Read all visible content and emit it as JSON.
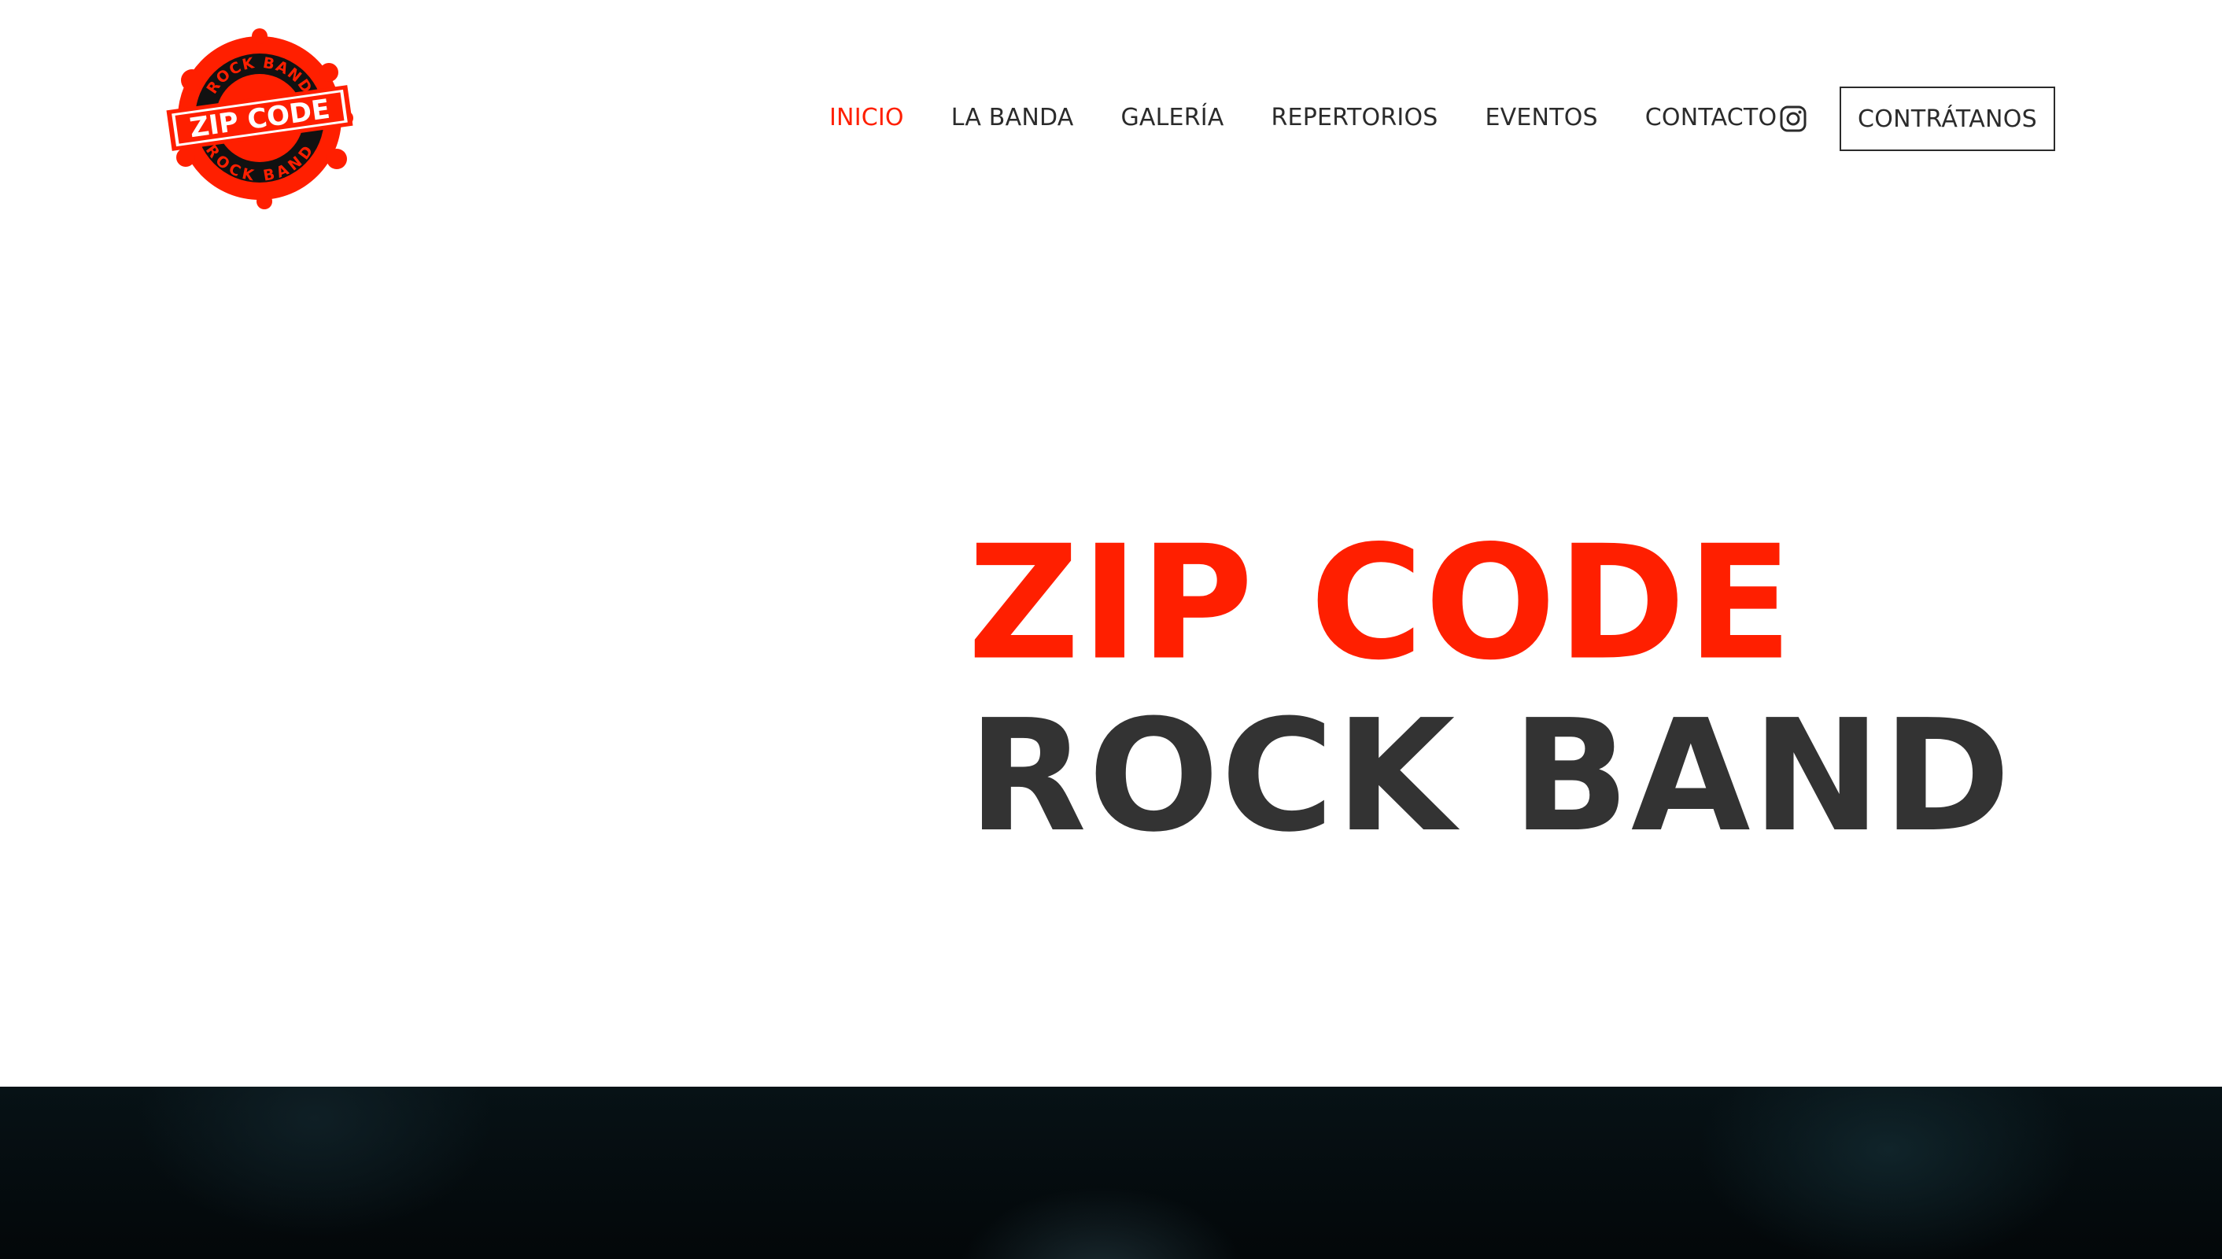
{
  "header": {
    "logo": {
      "alt": "ZIP CODE ROCK BAND",
      "text_main": "ZIP CODE",
      "text_ring_top": "ROCK BAND",
      "text_ring_bottom": "ROCK BAND"
    },
    "nav": [
      {
        "label": "INICIO",
        "active": true
      },
      {
        "label": "LA BANDA",
        "active": false
      },
      {
        "label": "GALERÍA",
        "active": false
      },
      {
        "label": "REPERTORIOS",
        "active": false
      },
      {
        "label": "EVENTOS",
        "active": false
      },
      {
        "label": "CONTACTO",
        "active": false
      }
    ],
    "social_icon": "instagram-icon",
    "cta_label": "CONTRÁTANOS"
  },
  "hero": {
    "line1": "ZIP CODE",
    "line2": "ROCK BAND"
  },
  "colors": {
    "accent": "#ff1f00",
    "text": "#2b2b2b",
    "hero_dark": "#333333",
    "band_dark": "#050b0e"
  }
}
